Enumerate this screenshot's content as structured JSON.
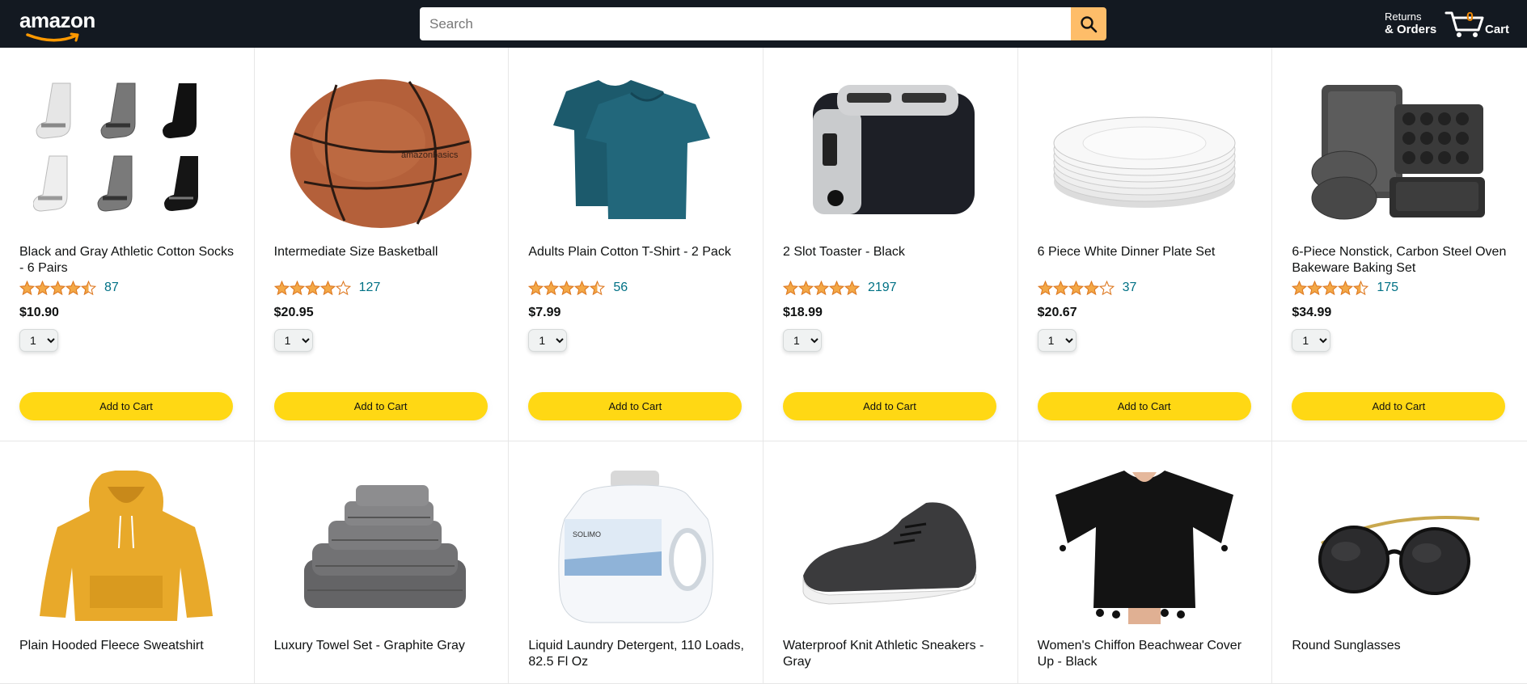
{
  "header": {
    "logo_text": "amazon",
    "search_placeholder": "Search",
    "returns_line1": "Returns",
    "returns_line2": "& Orders",
    "cart_count": "0",
    "cart_label": "Cart",
    "colors": {
      "bar": "#131921",
      "search_button": "#febd69",
      "cart_count": "#f08804"
    }
  },
  "products": [
    {
      "name": "Black and Gray Athletic Cotton Socks - 6 Pairs",
      "rating": 4.5,
      "count": "87",
      "price": "$10.90",
      "qty": "1",
      "button": "Add to Cart",
      "icon": "socks-image"
    },
    {
      "name": "Intermediate Size Basketball",
      "rating": 4,
      "count": "127",
      "price": "$20.95",
      "qty": "1",
      "button": "Add to Cart",
      "icon": "basketball-image"
    },
    {
      "name": "Adults Plain Cotton T-Shirt - 2 Pack",
      "rating": 4.5,
      "count": "56",
      "price": "$7.99",
      "qty": "1",
      "button": "Add to Cart",
      "icon": "tshirt-image"
    },
    {
      "name": "2 Slot Toaster - Black",
      "rating": 5,
      "count": "2197",
      "price": "$18.99",
      "qty": "1",
      "button": "Add to Cart",
      "icon": "toaster-image"
    },
    {
      "name": "6 Piece White Dinner Plate Set",
      "rating": 4,
      "count": "37",
      "price": "$20.67",
      "qty": "1",
      "button": "Add to Cart",
      "icon": "plates-image"
    },
    {
      "name": "6-Piece Nonstick, Carbon Steel Oven Bakeware Baking Set",
      "rating": 4.5,
      "count": "175",
      "price": "$34.99",
      "qty": "1",
      "button": "Add to Cart",
      "icon": "bakeware-image"
    },
    {
      "name": "Plain Hooded Fleece Sweatshirt",
      "icon": "hoodie-image"
    },
    {
      "name": "Luxury Towel Set - Graphite Gray",
      "icon": "towels-image"
    },
    {
      "name": "Liquid Laundry Detergent, 110 Loads, 82.5 Fl Oz",
      "icon": "detergent-image"
    },
    {
      "name": "Waterproof Knit Athletic Sneakers - Gray",
      "icon": "sneakers-image"
    },
    {
      "name": "Women's Chiffon Beachwear Cover Up - Black",
      "icon": "beachwear-image"
    },
    {
      "name": "Round Sunglasses",
      "icon": "sunglasses-image"
    }
  ]
}
